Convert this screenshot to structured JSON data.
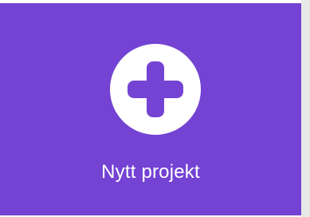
{
  "new_project_card": {
    "label": "Nytt projekt",
    "icon": "plus-icon",
    "colors": {
      "background": "#7443d3",
      "icon_circle": "#ffffff",
      "icon_cross": "#7443d3",
      "label": "#ffffff"
    }
  }
}
